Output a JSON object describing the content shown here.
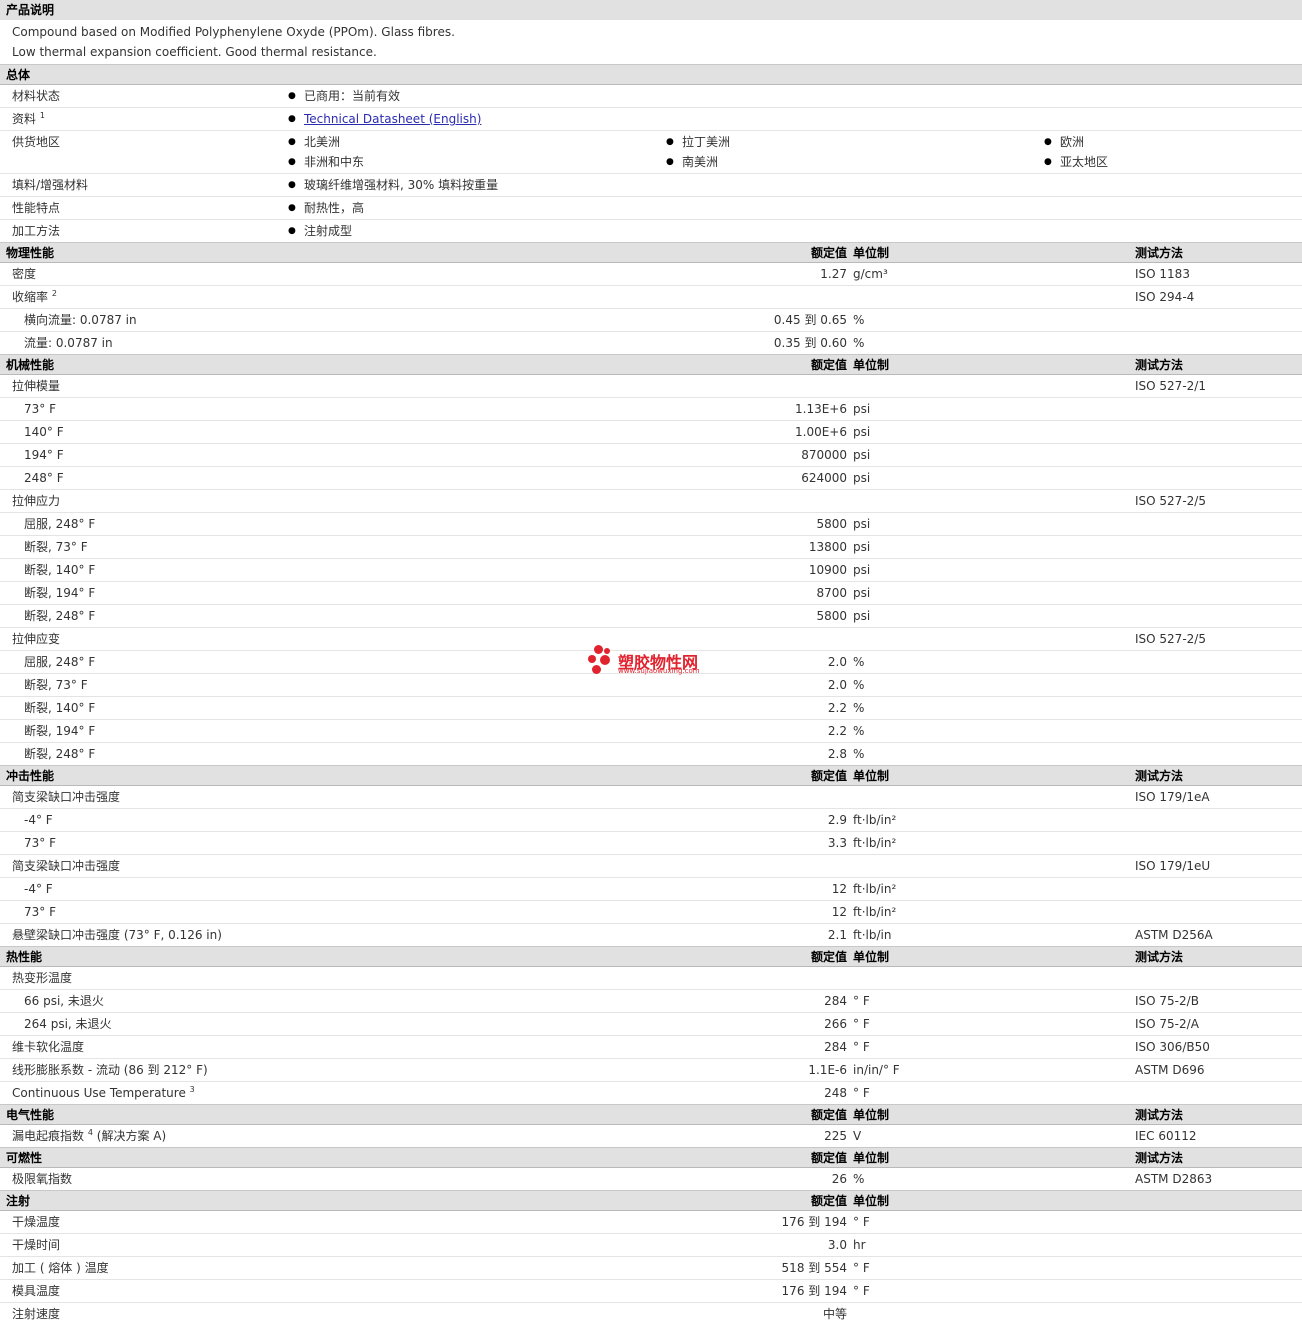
{
  "product": {
    "title": "产品说明",
    "lines": [
      "Compound based on Modified Polyphenylene Oxyde (PPOm). Glass fibres.",
      "Low thermal expansion coefficient. Good thermal resistance."
    ]
  },
  "general": {
    "title": "总体",
    "status_label": "材料状态",
    "status_value": "已商用：当前有效",
    "docs_label": "资料",
    "docs_sup": "1",
    "docs_link": "Technical Datasheet (English)",
    "regions_label": "供货地区",
    "regions": [
      "北美洲",
      "拉丁美洲",
      "欧洲",
      "非洲和中东",
      "南美洲",
      "亚太地区"
    ],
    "filler_label": "填料/增强材料",
    "filler_value": "玻璃纤维增强材料, 30% 填料按重量",
    "features_label": "性能特点",
    "features_value": "耐热性，高",
    "process_label": "加工方法",
    "process_value": "注射成型"
  },
  "headers": {
    "value": "额定值",
    "unit": "单位制",
    "method": "测试方法"
  },
  "physical": {
    "title": "物理性能",
    "rows": [
      {
        "p": "密度",
        "v": "1.27",
        "u": "g/cm³",
        "m": "ISO 1183"
      },
      {
        "p": "收缩率",
        "sup": "2",
        "v": "",
        "u": "",
        "m": "ISO 294-4"
      },
      {
        "p": "横向流量: 0.0787 in",
        "v": "0.45 到  0.65",
        "u": "%",
        "m": ""
      },
      {
        "p": "流量: 0.0787 in",
        "v": "0.35 到  0.60",
        "u": "%",
        "m": ""
      }
    ]
  },
  "mechanical": {
    "title": "机械性能",
    "rows": [
      {
        "p": "拉伸模量",
        "v": "",
        "u": "",
        "m": "ISO 527-2/1"
      },
      {
        "p": "73° F",
        "v": "1.13E+6",
        "u": "psi",
        "m": ""
      },
      {
        "p": "140° F",
        "v": "1.00E+6",
        "u": "psi",
        "m": ""
      },
      {
        "p": "194° F",
        "v": "870000",
        "u": "psi",
        "m": ""
      },
      {
        "p": "248° F",
        "v": "624000",
        "u": "psi",
        "m": ""
      },
      {
        "p": "拉伸应力",
        "v": "",
        "u": "",
        "m": "ISO 527-2/5"
      },
      {
        "p": "屈服, 248° F",
        "v": "5800",
        "u": "psi",
        "m": ""
      },
      {
        "p": "断裂, 73° F",
        "v": "13800",
        "u": "psi",
        "m": ""
      },
      {
        "p": "断裂, 140° F",
        "v": "10900",
        "u": "psi",
        "m": ""
      },
      {
        "p": "断裂, 194° F",
        "v": "8700",
        "u": "psi",
        "m": ""
      },
      {
        "p": "断裂, 248° F",
        "v": "5800",
        "u": "psi",
        "m": ""
      },
      {
        "p": "拉伸应变",
        "v": "",
        "u": "",
        "m": "ISO 527-2/5"
      },
      {
        "p": "屈服, 248° F",
        "v": "2.0",
        "u": "%",
        "m": ""
      },
      {
        "p": "断裂, 73° F",
        "v": "2.0",
        "u": "%",
        "m": ""
      },
      {
        "p": "断裂, 140° F",
        "v": "2.2",
        "u": "%",
        "m": ""
      },
      {
        "p": "断裂, 194° F",
        "v": "2.2",
        "u": "%",
        "m": ""
      },
      {
        "p": "断裂, 248° F",
        "v": "2.8",
        "u": "%",
        "m": ""
      }
    ]
  },
  "impact": {
    "title": "冲击性能",
    "rows": [
      {
        "p": "简支梁缺口冲击强度",
        "v": "",
        "u": "",
        "m": "ISO 179/1eA"
      },
      {
        "p": "-4° F",
        "v": "2.9",
        "u": "ft·lb/in²",
        "m": ""
      },
      {
        "p": "73° F",
        "v": "3.3",
        "u": "ft·lb/in²",
        "m": ""
      },
      {
        "p": "简支梁缺口冲击强度",
        "v": "",
        "u": "",
        "m": "ISO 179/1eU"
      },
      {
        "p": "-4° F",
        "v": "12",
        "u": "ft·lb/in²",
        "m": ""
      },
      {
        "p": "73° F",
        "v": "12",
        "u": "ft·lb/in²",
        "m": ""
      },
      {
        "p": "悬壁梁缺口冲击强度 (73° F, 0.126 in)",
        "v": "2.1",
        "u": "ft·lb/in",
        "m": "ASTM D256A"
      }
    ]
  },
  "thermal": {
    "title": "热性能",
    "rows": [
      {
        "p": "热变形温度",
        "v": "",
        "u": "",
        "m": ""
      },
      {
        "p": "66 psi, 未退火",
        "v": "284",
        "u": "° F",
        "m": "ISO 75-2/B"
      },
      {
        "p": "264 psi, 未退火",
        "v": "266",
        "u": "° F",
        "m": "ISO 75-2/A"
      },
      {
        "p": "维卡软化温度",
        "v": "284",
        "u": "° F",
        "m": "ISO 306/B50"
      },
      {
        "p": "线形膨胀系数 - 流动 (86 到  212° F)",
        "v": "1.1E-6",
        "u": "in/in/° F",
        "m": "ASTM D696"
      },
      {
        "p": "Continuous Use Temperature",
        "sup": "3",
        "v": "248",
        "u": "° F",
        "m": ""
      }
    ]
  },
  "electrical": {
    "title": "电气性能",
    "rows": [
      {
        "p": "漏电起痕指数",
        "sup": "4",
        "p2": "(解决方案 A)",
        "v": "225",
        "u": "V",
        "m": "IEC 60112"
      }
    ]
  },
  "flammability": {
    "title": "可燃性",
    "rows": [
      {
        "p": "极限氧指数",
        "v": "26",
        "u": "%",
        "m": "ASTM D2863"
      }
    ]
  },
  "injection": {
    "title": "注射",
    "rows": [
      {
        "p": "干燥温度",
        "v": "176 到  194",
        "u": "° F",
        "m": ""
      },
      {
        "p": "干燥时间",
        "v": "3.0",
        "u": "hr",
        "m": ""
      },
      {
        "p": "加工 ( 熔体 ) 温度",
        "v": "518 到  554",
        "u": "° F",
        "m": ""
      },
      {
        "p": "模具温度",
        "v": "176 到  194",
        "u": "° F",
        "m": ""
      },
      {
        "p": "注射速度",
        "v": "中等",
        "u": "",
        "m": ""
      }
    ]
  },
  "watermark": {
    "text": "塑胶物性网",
    "url": "www.sujiaowuxing.com",
    "color": "#e0232e"
  }
}
